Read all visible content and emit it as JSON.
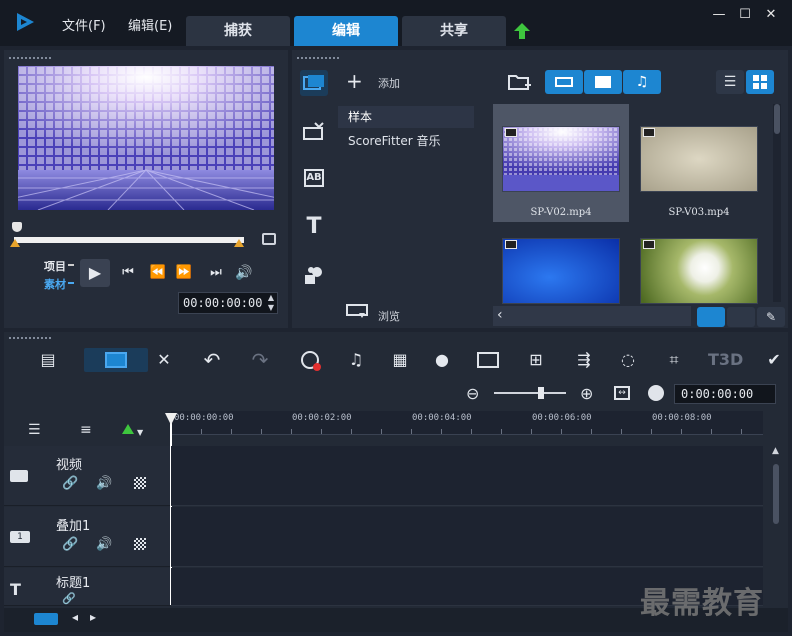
{
  "menu": {
    "file": "文件(F)",
    "edit": "编辑(E)"
  },
  "tabs": [
    {
      "label": "捕获",
      "active": false
    },
    {
      "label": "编辑",
      "active": true
    },
    {
      "label": "共享",
      "active": false
    }
  ],
  "window_controls": {
    "minimize": "—",
    "maximize": "☐",
    "close": "✕"
  },
  "preview": {
    "mode_project": "项目",
    "mode_clip": "素材",
    "timecode": "00:00:00:00"
  },
  "library": {
    "add_label": "添加",
    "browse_label": "浏览",
    "items": [
      {
        "label": "样本",
        "selected": true
      },
      {
        "label": "ScoreFitter 音乐",
        "selected": false
      }
    ],
    "thumbnails": [
      {
        "name": "SP-V02.mp4",
        "selected": true
      },
      {
        "name": "SP-V03.mp4",
        "selected": false
      },
      {
        "name": "",
        "selected": false
      },
      {
        "name": "",
        "selected": false
      }
    ]
  },
  "timeline": {
    "zoom_timecode": "0:00:00:00",
    "ruler": [
      "00:00:00:00",
      "00:00:02:00",
      "00:00:04:00",
      "00:00:06:00",
      "00:00:08:00"
    ],
    "tracks": [
      {
        "name": "视频"
      },
      {
        "name": "叠加1"
      },
      {
        "name": "标题1"
      }
    ]
  },
  "watermark": "最需教育",
  "colors": {
    "accent": "#1d86d1",
    "background": "#1e2430",
    "panel": "#252c39",
    "handle": "#e8a42c"
  }
}
